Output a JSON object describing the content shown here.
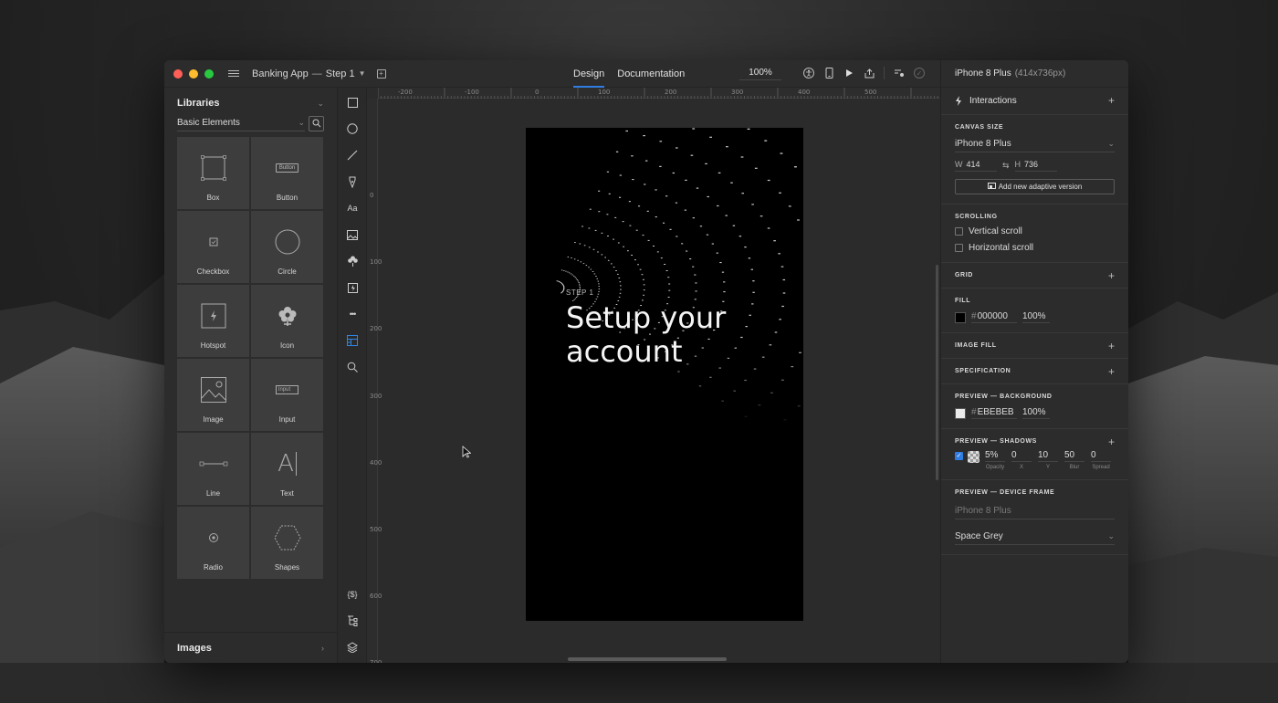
{
  "window": {
    "project_name": "Banking App",
    "separator": "—",
    "screen_name": "Step 1",
    "zoom": "100%"
  },
  "tabs": [
    {
      "label": "Design",
      "active": true
    },
    {
      "label": "Documentation",
      "active": false
    }
  ],
  "libraries": {
    "title": "Libraries",
    "selected_library": "Basic Elements",
    "elements": [
      {
        "label": "Box",
        "icon": "box-icon"
      },
      {
        "label": "Button",
        "icon": "button-icon"
      },
      {
        "label": "Checkbox",
        "icon": "checkbox-icon"
      },
      {
        "label": "Circle",
        "icon": "circle-icon"
      },
      {
        "label": "Hotspot",
        "icon": "hotspot-icon"
      },
      {
        "label": "Icon",
        "icon": "flower-icon"
      },
      {
        "label": "Image",
        "icon": "image-icon"
      },
      {
        "label": "Input",
        "icon": "input-icon"
      },
      {
        "label": "Line",
        "icon": "line-icon"
      },
      {
        "label": "Text",
        "icon": "text-icon"
      },
      {
        "label": "Radio",
        "icon": "radio-icon"
      },
      {
        "label": "Shapes",
        "icon": "hexagon-icon"
      }
    ],
    "button_preview": "Button",
    "input_preview": "Input",
    "text_preview": "A",
    "images_label": "Images"
  },
  "tools": {
    "text_tool": "Aa",
    "variables_tool": "{$}",
    "more_tool": "•••"
  },
  "canvas": {
    "ruler_top": [
      "-200",
      "-100",
      "0",
      "100",
      "200",
      "300",
      "400",
      "500"
    ],
    "ruler_left": [
      "0",
      "100",
      "200",
      "300",
      "400",
      "500",
      "600",
      "700"
    ],
    "artboard": {
      "step_label": "STEP 1",
      "headline": "Setup your\naccount",
      "background": "#000000"
    }
  },
  "properties": {
    "device": "iPhone 8 Plus",
    "device_size": "(414x736px)",
    "interactions_label": "Interactions",
    "canvas_size": {
      "title": "CANVAS SIZE",
      "device": "iPhone 8 Plus",
      "w_label": "W",
      "w": "414",
      "h_label": "H",
      "h": "736",
      "link_symbol": "⇆",
      "adaptive_button": "Add new adaptive version"
    },
    "scrolling": {
      "title": "SCROLLING",
      "vertical": "Vertical scroll",
      "horizontal": "Horizontal scroll"
    },
    "grid_title": "GRID",
    "fill": {
      "title": "FILL",
      "hash": "#",
      "hex": "000000",
      "opacity": "100%",
      "color": "#000000"
    },
    "image_fill_title": "IMAGE FILL",
    "specification_title": "SPECIFICATION",
    "preview_background": {
      "title": "PREVIEW — BACKGROUND",
      "hash": "#",
      "hex": "EBEBEB",
      "opacity": "100%",
      "color": "#EBEBEB"
    },
    "preview_shadows": {
      "title": "PREVIEW — SHADOWS",
      "enabled": true,
      "fields": [
        {
          "value": "5%",
          "label": "Opacity"
        },
        {
          "value": "0",
          "label": "X"
        },
        {
          "value": "10",
          "label": "Y"
        },
        {
          "value": "50",
          "label": "Blur"
        },
        {
          "value": "0",
          "label": "Spread"
        }
      ]
    },
    "preview_device_frame": {
      "title": "PREVIEW — DEVICE FRAME",
      "device_placeholder": "iPhone 8 Plus",
      "frame_color": "Space Grey"
    }
  },
  "colors": {
    "accent": "#2F7DE1",
    "window_bg": "#2C2C2C",
    "tile_bg": "#3D3D3D"
  }
}
